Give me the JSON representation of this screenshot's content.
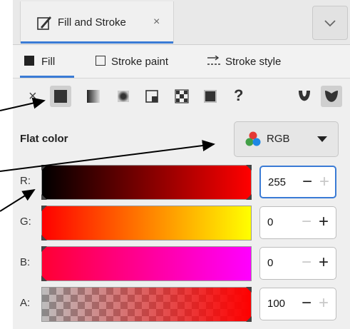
{
  "panel": {
    "title": "Fill and Stroke",
    "close_glyph": "×",
    "menu_icon": "chevron-down-icon"
  },
  "subtabs": [
    {
      "label": "Fill",
      "icon": "fill-square-icon",
      "active": true
    },
    {
      "label": "Stroke paint",
      "icon": "stroke-square-icon",
      "active": false
    },
    {
      "label": "Stroke style",
      "icon": "stroke-style-icon",
      "active": false
    }
  ],
  "paint_types": {
    "none_glyph": "×",
    "unset_glyph": "?",
    "items": [
      "flat-color-icon",
      "linear-gradient-icon",
      "radial-gradient-icon",
      "mesh-gradient-icon",
      "pattern-icon",
      "swatch-icon",
      "unset-icon",
      "fill-rule-evenodd-icon",
      "fill-rule-nonzero-icon"
    ],
    "selected": "flat-color-icon"
  },
  "flat": {
    "label": "Flat color",
    "mode": "RGB"
  },
  "channels": [
    {
      "label": "R:",
      "value": "255"
    },
    {
      "label": "G:",
      "value": "0"
    },
    {
      "label": "B:",
      "value": "0"
    },
    {
      "label": "A:",
      "value": "100"
    }
  ],
  "colors": {
    "accent": "#3a7bd5",
    "selected_color": "#ff0000"
  }
}
